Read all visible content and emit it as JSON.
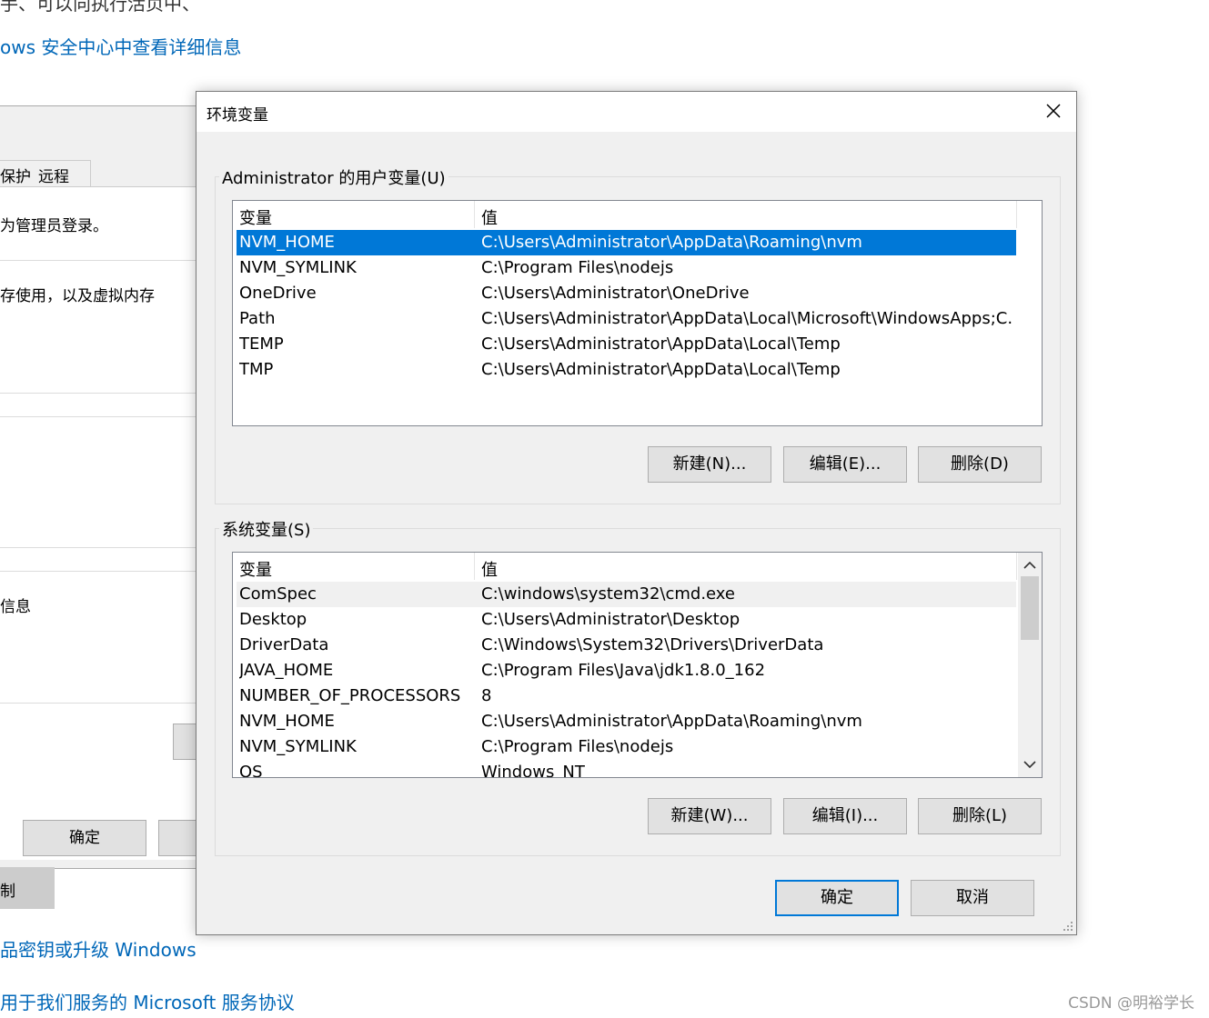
{
  "background": {
    "top_cut_text": "手、可以向执行活页中、",
    "links": [
      "ows 安全中心中查看详细信息",
      "品密钥或升级 Windows",
      "用于我们服务的 Microsoft 服务协议"
    ],
    "sysprop": {
      "tabs": [
        "保护",
        "远程"
      ],
      "text_admin": "为管理员登录。",
      "text_memory": "存使用，以及虚拟内存",
      "text_info": "信息",
      "ok_label": "确定"
    },
    "strip_text": "制"
  },
  "dialog": {
    "title": "环境变量",
    "user_group_label": "Administrator 的用户变量(U)",
    "system_group_label": "系统变量(S)",
    "columns": [
      "变量",
      "值"
    ],
    "user_vars": [
      {
        "name": "NVM_HOME",
        "value": "C:\\Users\\Administrator\\AppData\\Roaming\\nvm"
      },
      {
        "name": "NVM_SYMLINK",
        "value": "C:\\Program Files\\nodejs"
      },
      {
        "name": "OneDrive",
        "value": "C:\\Users\\Administrator\\OneDrive"
      },
      {
        "name": "Path",
        "value": "C:\\Users\\Administrator\\AppData\\Local\\Microsoft\\WindowsApps;C..."
      },
      {
        "name": "TEMP",
        "value": "C:\\Users\\Administrator\\AppData\\Local\\Temp"
      },
      {
        "name": "TMP",
        "value": "C:\\Users\\Administrator\\AppData\\Local\\Temp"
      }
    ],
    "system_vars": [
      {
        "name": "ComSpec",
        "value": "C:\\windows\\system32\\cmd.exe"
      },
      {
        "name": "Desktop",
        "value": "C:\\Users\\Administrator\\Desktop"
      },
      {
        "name": "DriverData",
        "value": "C:\\Windows\\System32\\Drivers\\DriverData"
      },
      {
        "name": "JAVA_HOME",
        "value": "C:\\Program Files\\Java\\jdk1.8.0_162"
      },
      {
        "name": "NUMBER_OF_PROCESSORS",
        "value": "8"
      },
      {
        "name": "NVM_HOME",
        "value": "C:\\Users\\Administrator\\AppData\\Roaming\\nvm"
      },
      {
        "name": "NVM_SYMLINK",
        "value": "C:\\Program Files\\nodejs"
      },
      {
        "name": "OS",
        "value": "Windows_NT"
      }
    ],
    "user_buttons": {
      "new": "新建(N)...",
      "edit": "编辑(E)...",
      "delete": "删除(D)"
    },
    "system_buttons": {
      "new": "新建(W)...",
      "edit": "编辑(I)...",
      "delete": "删除(L)"
    },
    "ok_label": "确定",
    "cancel_label": "取消",
    "selected_user_index": 0,
    "accent_color": "#0078d7"
  },
  "watermark": "CSDN @明裕学长"
}
